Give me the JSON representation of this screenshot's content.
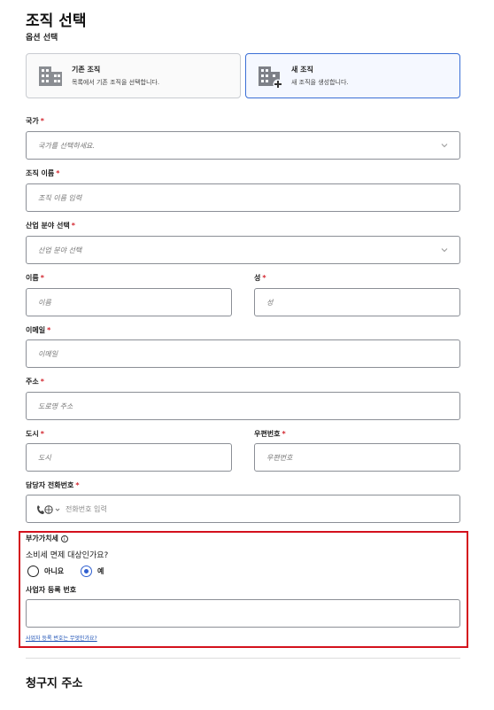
{
  "header": {
    "title": "조직 선택",
    "subtitle": "옵션 선택"
  },
  "org_options": [
    {
      "title": "기존 조직",
      "description": "목록에서 기존 조직을 선택합니다.",
      "selected": false,
      "icon": "building-icon"
    },
    {
      "title": "새 조직",
      "description": "새 조직을 생성합니다.",
      "selected": true,
      "icon": "building-add-icon"
    }
  ],
  "form": {
    "required_mark": "*",
    "country": {
      "label": "국가",
      "placeholder": "국가를 선택하세요."
    },
    "org_name": {
      "label": "조직 이름",
      "placeholder": "조직 이름 입력"
    },
    "industry": {
      "label": "산업 분야 선택",
      "placeholder": "산업 분야 선택"
    },
    "first_name": {
      "label": "이름",
      "placeholder": "이름"
    },
    "last_name": {
      "label": "성",
      "placeholder": "성"
    },
    "email": {
      "label": "이메일",
      "placeholder": "이메일"
    },
    "address": {
      "label": "주소",
      "placeholder": "도로명 주소"
    },
    "city": {
      "label": "도시",
      "placeholder": "도시"
    },
    "postal": {
      "label": "우편번호",
      "placeholder": "우편번호"
    },
    "phone": {
      "label": "담당자 전화번호",
      "placeholder": "전화번호 입력",
      "country_icon": "globe-phone-icon"
    }
  },
  "vat": {
    "title": "부가가치세",
    "info_glyph": "i",
    "question": "소비세 면제 대상인가요?",
    "options": [
      {
        "label": "아니요",
        "checked": false
      },
      {
        "label": "예",
        "checked": true
      }
    ],
    "reg_label": "사업자 등록 번호",
    "reg_value": "",
    "help_link": "사업자 등록 번호는 무엇인가요?"
  },
  "billing": {
    "title": "청구지 주소"
  },
  "colors": {
    "accent": "#2f5fd0",
    "highlight_border": "#d4111d",
    "required": "#d3262f"
  }
}
